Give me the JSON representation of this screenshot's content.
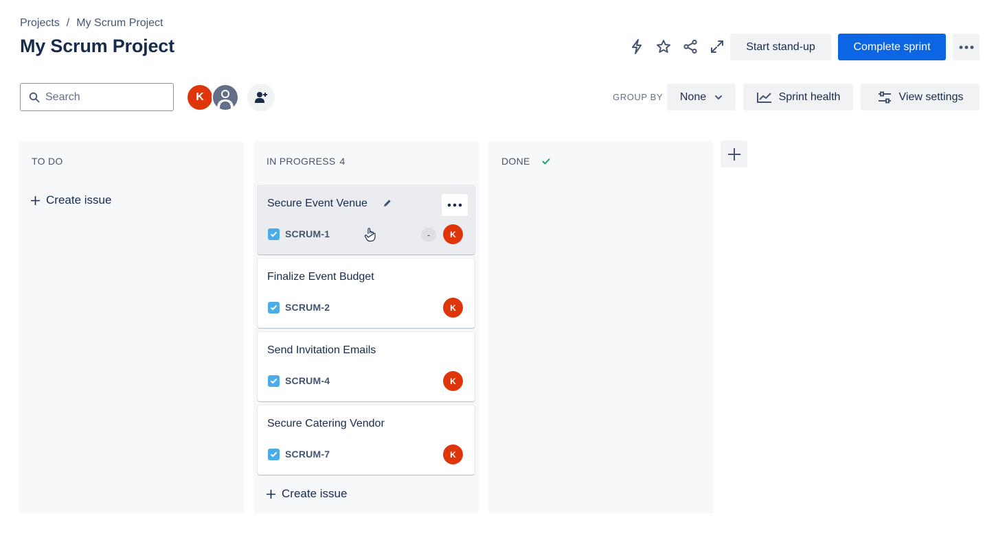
{
  "breadcrumb": {
    "root": "Projects",
    "separator": "/",
    "current": "My Scrum Project"
  },
  "page_title": "My Scrum Project",
  "header_actions": {
    "automation_icon": "lightning-icon",
    "star_icon": "star-icon",
    "share_icon": "share-icon",
    "fullscreen_icon": "expand-icon",
    "standup_label": "Start stand-up",
    "complete_label": "Complete sprint",
    "more_icon": "ellipsis-icon"
  },
  "toolbar": {
    "search_placeholder": "Search",
    "avatars": [
      {
        "initial": "K",
        "color": "#de350b"
      }
    ],
    "group_by_label": "GROUP BY",
    "group_by_value": "None",
    "sprint_health_label": "Sprint health",
    "view_settings_label": "View settings"
  },
  "columns": [
    {
      "title": "TO DO",
      "count": "",
      "create_label": "Create issue",
      "cards": []
    },
    {
      "title": "IN PROGRESS",
      "count": "4",
      "create_label": "Create issue",
      "cards": [
        {
          "title": "Secure Event Venue",
          "key": "SCRUM-1",
          "estimate": "-",
          "assignee": "K"
        },
        {
          "title": "Finalize Event Budget",
          "key": "SCRUM-2",
          "assignee": "K"
        },
        {
          "title": "Send Invitation Emails",
          "key": "SCRUM-4",
          "assignee": "K"
        },
        {
          "title": "Secure Catering Vendor",
          "key": "SCRUM-7",
          "assignee": "K"
        }
      ]
    },
    {
      "title": "DONE",
      "count": "",
      "create_label": "",
      "cards": []
    }
  ],
  "colors": {
    "primary": "#0c66e4",
    "avatar": "#de350b",
    "done_check": "#22a06b",
    "issue_type": "#4bade8"
  }
}
